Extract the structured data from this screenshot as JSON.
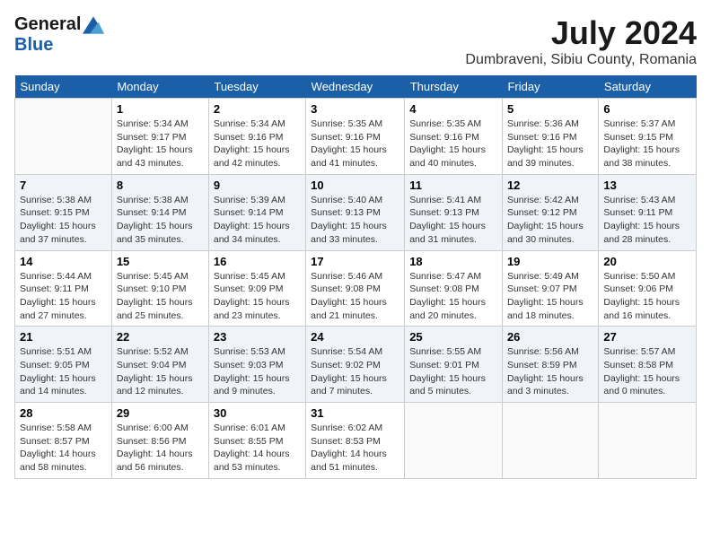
{
  "header": {
    "logo_general": "General",
    "logo_blue": "Blue",
    "title": "July 2024",
    "location": "Dumbraveni, Sibiu County, Romania"
  },
  "calendar": {
    "days_of_week": [
      "Sunday",
      "Monday",
      "Tuesday",
      "Wednesday",
      "Thursday",
      "Friday",
      "Saturday"
    ],
    "weeks": [
      [
        {
          "day": "",
          "info": ""
        },
        {
          "day": "1",
          "info": "Sunrise: 5:34 AM\nSunset: 9:17 PM\nDaylight: 15 hours\nand 43 minutes."
        },
        {
          "day": "2",
          "info": "Sunrise: 5:34 AM\nSunset: 9:16 PM\nDaylight: 15 hours\nand 42 minutes."
        },
        {
          "day": "3",
          "info": "Sunrise: 5:35 AM\nSunset: 9:16 PM\nDaylight: 15 hours\nand 41 minutes."
        },
        {
          "day": "4",
          "info": "Sunrise: 5:35 AM\nSunset: 9:16 PM\nDaylight: 15 hours\nand 40 minutes."
        },
        {
          "day": "5",
          "info": "Sunrise: 5:36 AM\nSunset: 9:16 PM\nDaylight: 15 hours\nand 39 minutes."
        },
        {
          "day": "6",
          "info": "Sunrise: 5:37 AM\nSunset: 9:15 PM\nDaylight: 15 hours\nand 38 minutes."
        }
      ],
      [
        {
          "day": "7",
          "info": "Sunrise: 5:38 AM\nSunset: 9:15 PM\nDaylight: 15 hours\nand 37 minutes."
        },
        {
          "day": "8",
          "info": "Sunrise: 5:38 AM\nSunset: 9:14 PM\nDaylight: 15 hours\nand 35 minutes."
        },
        {
          "day": "9",
          "info": "Sunrise: 5:39 AM\nSunset: 9:14 PM\nDaylight: 15 hours\nand 34 minutes."
        },
        {
          "day": "10",
          "info": "Sunrise: 5:40 AM\nSunset: 9:13 PM\nDaylight: 15 hours\nand 33 minutes."
        },
        {
          "day": "11",
          "info": "Sunrise: 5:41 AM\nSunset: 9:13 PM\nDaylight: 15 hours\nand 31 minutes."
        },
        {
          "day": "12",
          "info": "Sunrise: 5:42 AM\nSunset: 9:12 PM\nDaylight: 15 hours\nand 30 minutes."
        },
        {
          "day": "13",
          "info": "Sunrise: 5:43 AM\nSunset: 9:11 PM\nDaylight: 15 hours\nand 28 minutes."
        }
      ],
      [
        {
          "day": "14",
          "info": "Sunrise: 5:44 AM\nSunset: 9:11 PM\nDaylight: 15 hours\nand 27 minutes."
        },
        {
          "day": "15",
          "info": "Sunrise: 5:45 AM\nSunset: 9:10 PM\nDaylight: 15 hours\nand 25 minutes."
        },
        {
          "day": "16",
          "info": "Sunrise: 5:45 AM\nSunset: 9:09 PM\nDaylight: 15 hours\nand 23 minutes."
        },
        {
          "day": "17",
          "info": "Sunrise: 5:46 AM\nSunset: 9:08 PM\nDaylight: 15 hours\nand 21 minutes."
        },
        {
          "day": "18",
          "info": "Sunrise: 5:47 AM\nSunset: 9:08 PM\nDaylight: 15 hours\nand 20 minutes."
        },
        {
          "day": "19",
          "info": "Sunrise: 5:49 AM\nSunset: 9:07 PM\nDaylight: 15 hours\nand 18 minutes."
        },
        {
          "day": "20",
          "info": "Sunrise: 5:50 AM\nSunset: 9:06 PM\nDaylight: 15 hours\nand 16 minutes."
        }
      ],
      [
        {
          "day": "21",
          "info": "Sunrise: 5:51 AM\nSunset: 9:05 PM\nDaylight: 15 hours\nand 14 minutes."
        },
        {
          "day": "22",
          "info": "Sunrise: 5:52 AM\nSunset: 9:04 PM\nDaylight: 15 hours\nand 12 minutes."
        },
        {
          "day": "23",
          "info": "Sunrise: 5:53 AM\nSunset: 9:03 PM\nDaylight: 15 hours\nand 9 minutes."
        },
        {
          "day": "24",
          "info": "Sunrise: 5:54 AM\nSunset: 9:02 PM\nDaylight: 15 hours\nand 7 minutes."
        },
        {
          "day": "25",
          "info": "Sunrise: 5:55 AM\nSunset: 9:01 PM\nDaylight: 15 hours\nand 5 minutes."
        },
        {
          "day": "26",
          "info": "Sunrise: 5:56 AM\nSunset: 8:59 PM\nDaylight: 15 hours\nand 3 minutes."
        },
        {
          "day": "27",
          "info": "Sunrise: 5:57 AM\nSunset: 8:58 PM\nDaylight: 15 hours\nand 0 minutes."
        }
      ],
      [
        {
          "day": "28",
          "info": "Sunrise: 5:58 AM\nSunset: 8:57 PM\nDaylight: 14 hours\nand 58 minutes."
        },
        {
          "day": "29",
          "info": "Sunrise: 6:00 AM\nSunset: 8:56 PM\nDaylight: 14 hours\nand 56 minutes."
        },
        {
          "day": "30",
          "info": "Sunrise: 6:01 AM\nSunset: 8:55 PM\nDaylight: 14 hours\nand 53 minutes."
        },
        {
          "day": "31",
          "info": "Sunrise: 6:02 AM\nSunset: 8:53 PM\nDaylight: 14 hours\nand 51 minutes."
        },
        {
          "day": "",
          "info": ""
        },
        {
          "day": "",
          "info": ""
        },
        {
          "day": "",
          "info": ""
        }
      ]
    ]
  }
}
